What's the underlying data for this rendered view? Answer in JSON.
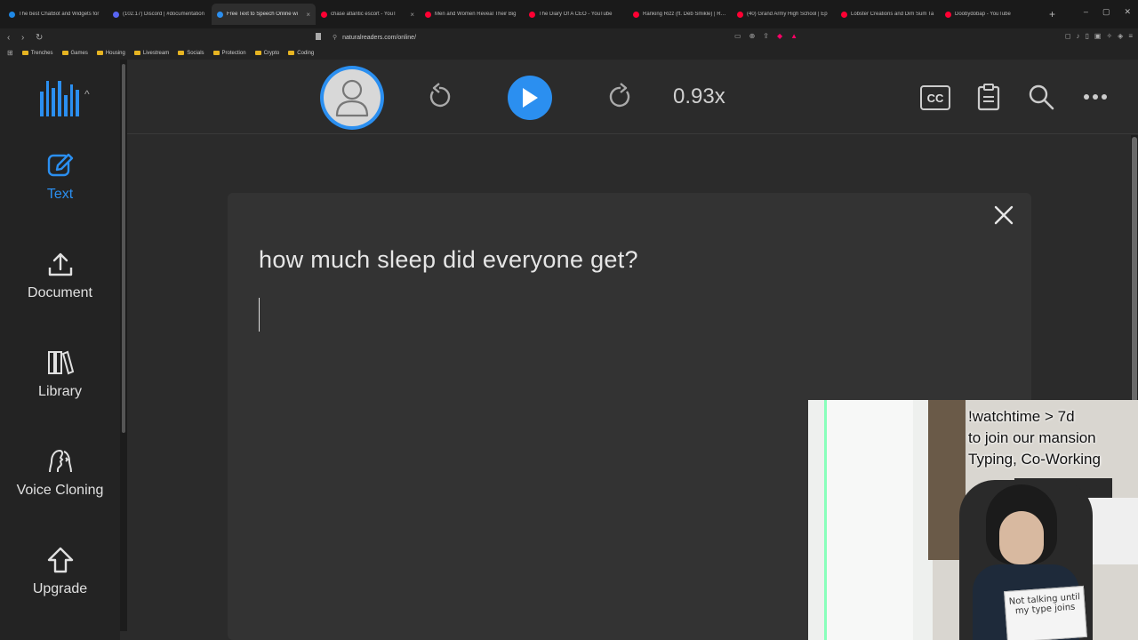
{
  "browser": {
    "tabs": [
      {
        "label": "The best ChatBot and Widgets for",
        "color": "#1e88e5",
        "active": false
      },
      {
        "label": "(102.17) Discord | #documentation",
        "color": "#5865f2",
        "active": false
      },
      {
        "label": "Free Text to Speech Online wi",
        "color": "#2b8ff0",
        "active": true
      },
      {
        "label": "chase atlantic escort - YouT",
        "color": "#ff0033",
        "active": false
      },
      {
        "label": "Men and Women Reveal Their Big",
        "color": "#ff0033",
        "active": false
      },
      {
        "label": "The Diary Of A CEO - YouTube",
        "color": "#ff0033",
        "active": false
      },
      {
        "label": "Ranking Rizz (ft. Deb Smikle) | Rea",
        "color": "#ff0033",
        "active": false
      },
      {
        "label": "(40) Grand Army High School | Ep",
        "color": "#ff0033",
        "active": false
      },
      {
        "label": "Lobster Creations and Dim Sum Ta",
        "color": "#ff0033",
        "active": false
      },
      {
        "label": "Doobydobap - YouTube",
        "color": "#ff0033",
        "active": false
      }
    ],
    "url": "naturalreaders.com/online/",
    "bookmarks": [
      "Trenches",
      "Games",
      "Housing",
      "Livestream",
      "Socials",
      "Protection",
      "Crypto",
      "Coding"
    ]
  },
  "sidebar": {
    "items": [
      {
        "label": "Text",
        "icon": "edit-icon",
        "active": true
      },
      {
        "label": "Document",
        "icon": "upload-icon",
        "active": false
      },
      {
        "label": "Library",
        "icon": "library-icon",
        "active": false
      },
      {
        "label": "Voice Cloning",
        "icon": "voice-clone-icon",
        "active": false
      },
      {
        "label": "Upgrade",
        "icon": "upgrade-icon",
        "active": false
      }
    ]
  },
  "toolbar": {
    "speed": "0.93x",
    "cc_label": "CC"
  },
  "editor": {
    "text": "how much sleep did everyone get?"
  },
  "stream_overlay": {
    "line1": "!watchtime > 7d",
    "line2": "to join our mansion",
    "line3": "Typing, Co-Working",
    "sign_text": "Not talking until my type joins"
  },
  "colors": {
    "accent": "#2b8ff0",
    "background": "#2b2b2b",
    "sidebar": "#232323"
  }
}
